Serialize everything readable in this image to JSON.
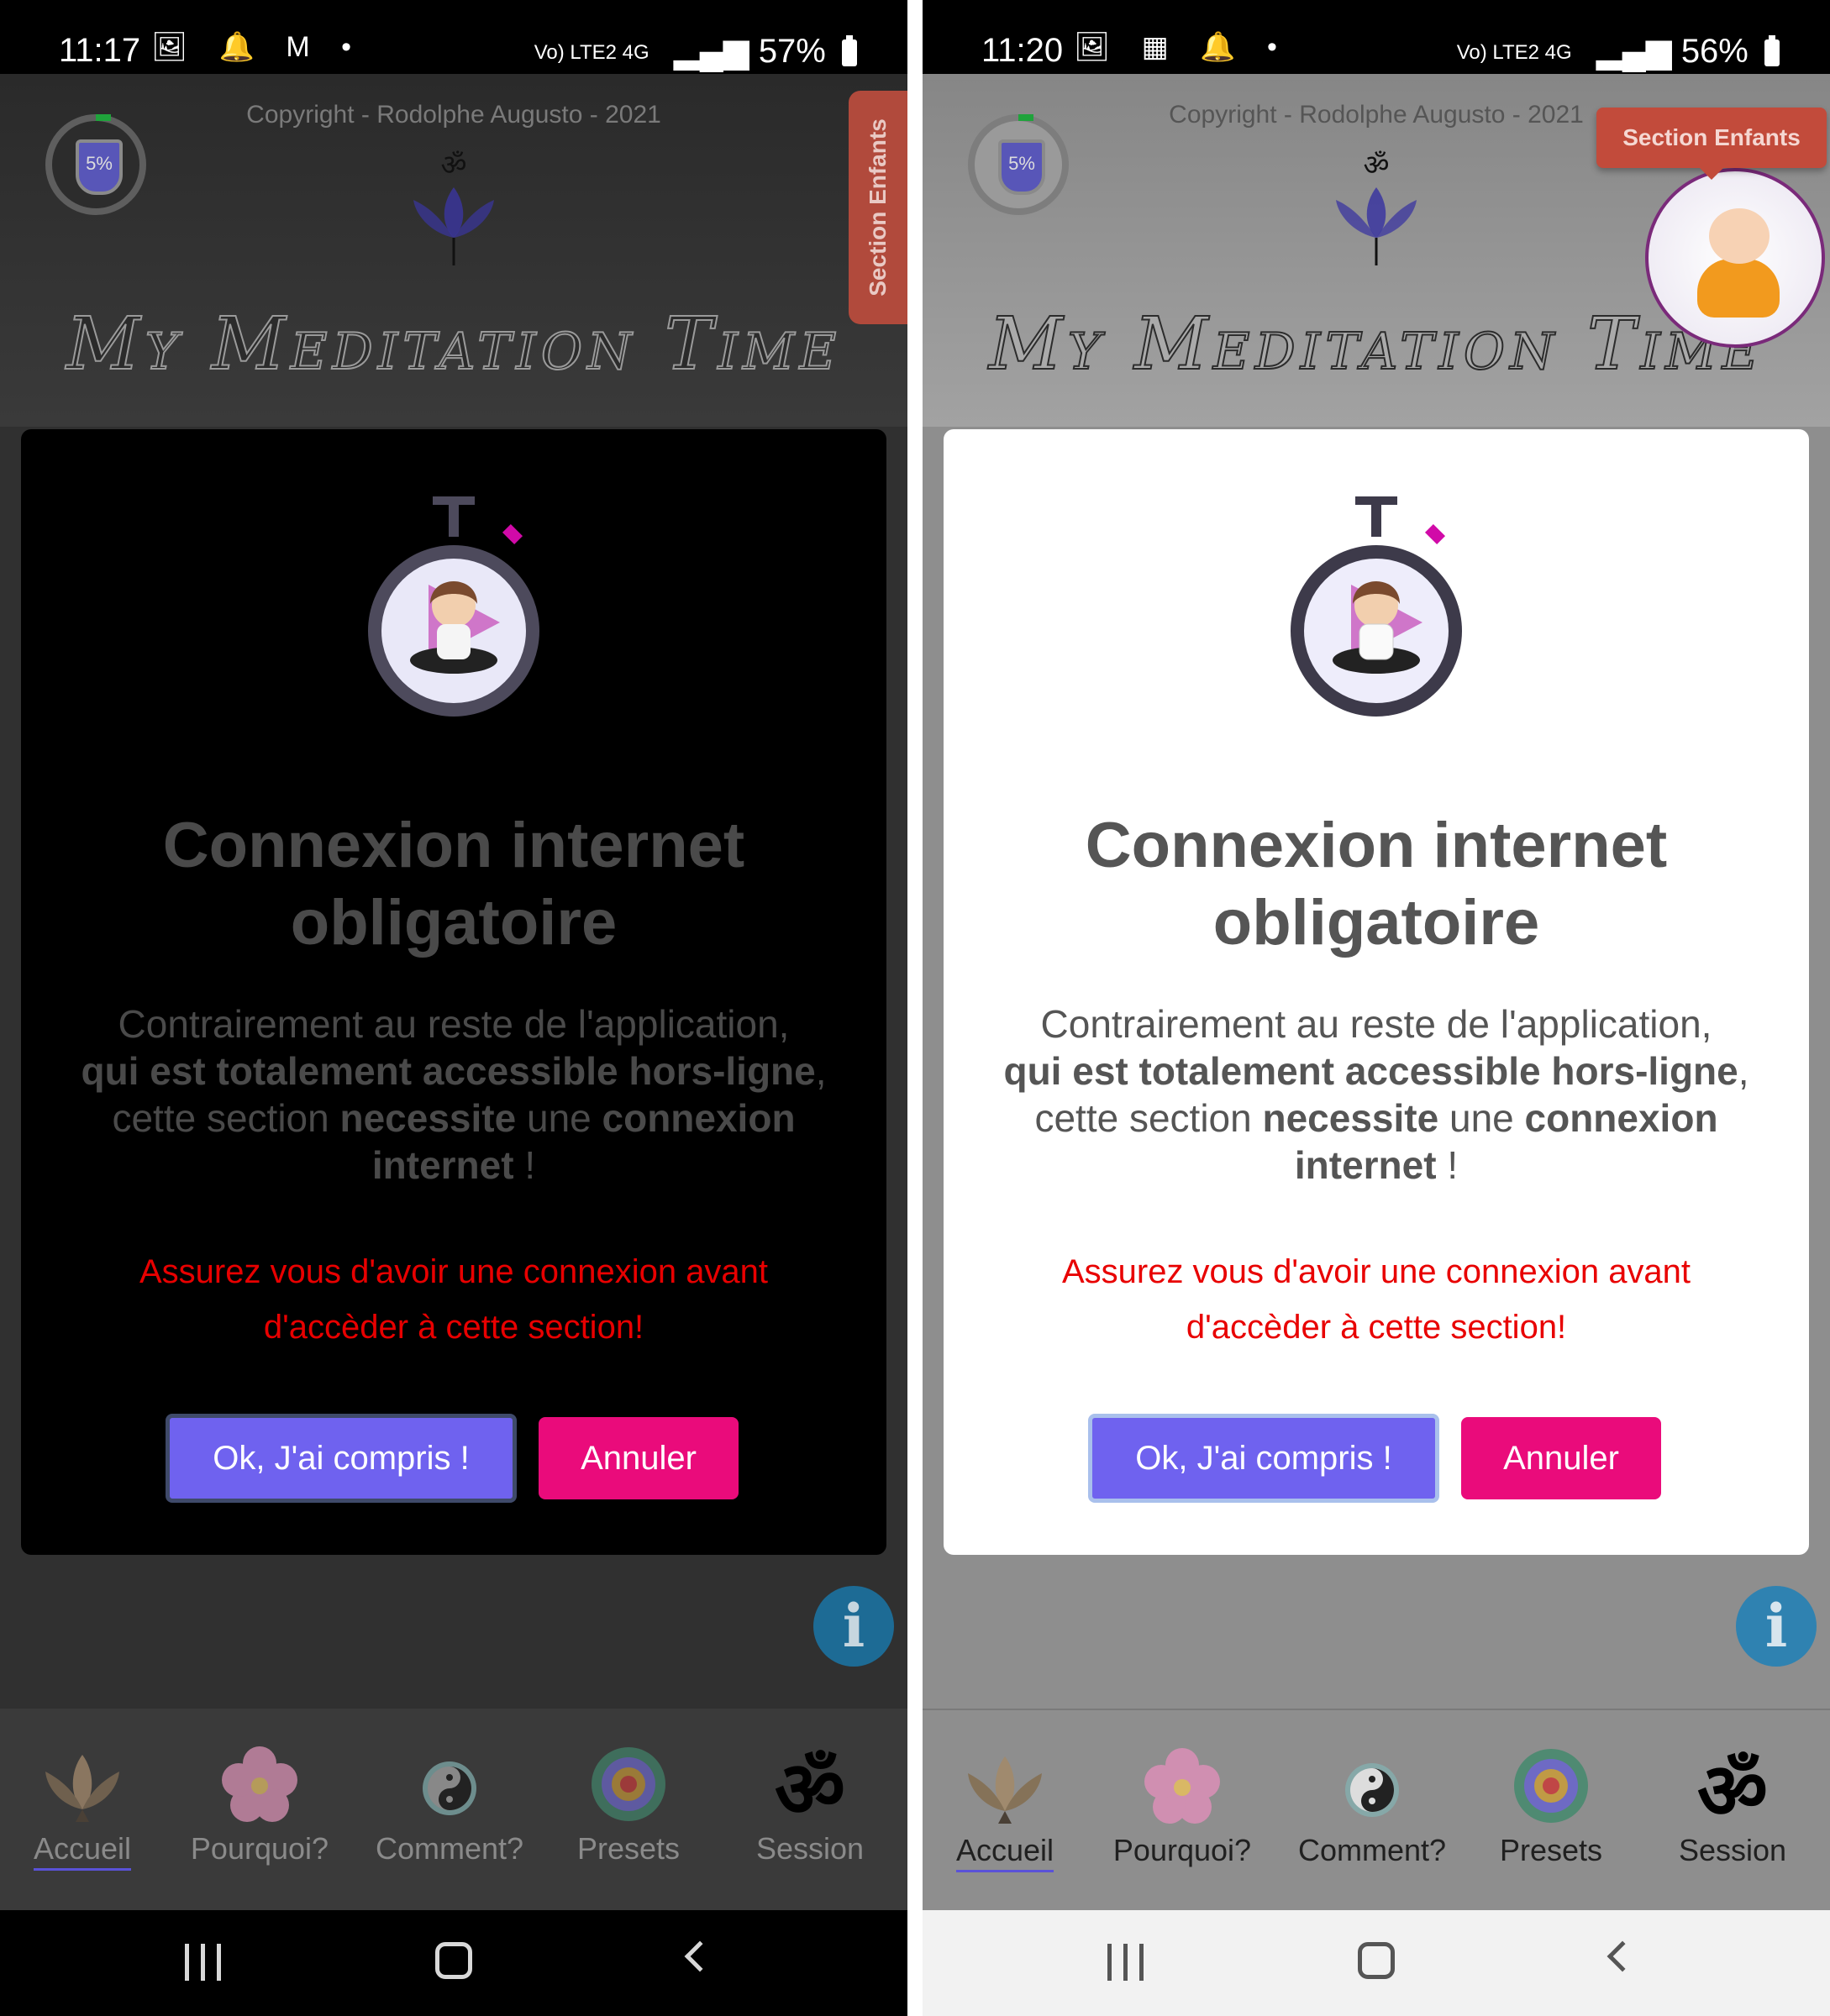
{
  "screens": [
    {
      "theme": "dark",
      "status": {
        "time": "11:17",
        "icons": "🖼 🔔 M •",
        "net": "Vo) LTE2 4G",
        "battery": "57%"
      },
      "copyright": "Copyright - Rodolphe Augusto - 2021",
      "progress_label": "5%",
      "progress_value_pct": 5,
      "app_title": "My Meditation Time",
      "kids_tab": "Section Enfants",
      "modal": {
        "title": "Connexion internet obligatoire",
        "body_1": "Contrairement au reste de l'application,",
        "body_bold_1": "qui est totalement accessible hors-ligne",
        "body_2": ",",
        "body_3": "cette section",
        "body_bold_2": "necessite",
        "body_4": "une",
        "body_bold_3": "connexion internet",
        "body_5": "!",
        "warning": "Assurez vous d'avoir une connexion avant d'accèder à cette section!",
        "ok_label": "Ok, J'ai compris !",
        "cancel_label": "Annuler"
      },
      "info_label": "i",
      "nav": [
        {
          "label": "Accueil",
          "icon": "lotus-icon",
          "active": true
        },
        {
          "label": "Pourquoi?",
          "icon": "flower-icon",
          "active": false
        },
        {
          "label": "Comment?",
          "icon": "yin-yang-icon",
          "active": false
        },
        {
          "label": "Presets",
          "icon": "mandala-icon",
          "active": false
        },
        {
          "label": "Session",
          "icon": "om-icon",
          "active": false
        }
      ]
    },
    {
      "theme": "light",
      "status": {
        "time": "11:20",
        "icons": "🖼 ▦ 🔔 •",
        "net": "Vo) LTE2 4G",
        "battery": "56%"
      },
      "copyright": "Copyright - Rodolphe Augusto - 2021",
      "progress_label": "5%",
      "progress_value_pct": 5,
      "app_title": "My Meditation Time",
      "kids_tab": "Section Enfants",
      "modal": {
        "title": "Connexion internet obligatoire",
        "body_1": "Contrairement au reste de l'application,",
        "body_bold_1": "qui est totalement accessible hors-ligne",
        "body_2": ",",
        "body_3": "cette section",
        "body_bold_2": "necessite",
        "body_4": "une",
        "body_bold_3": "connexion internet",
        "body_5": "!",
        "warning": "Assurez vous d'avoir une connexion avant d'accèder à cette section!",
        "ok_label": "Ok, J'ai compris !",
        "cancel_label": "Annuler"
      },
      "info_label": "i",
      "nav": [
        {
          "label": "Accueil",
          "icon": "lotus-icon",
          "active": true
        },
        {
          "label": "Pourquoi?",
          "icon": "flower-icon",
          "active": false
        },
        {
          "label": "Comment?",
          "icon": "yin-yang-icon",
          "active": false
        },
        {
          "label": "Presets",
          "icon": "mandala-icon",
          "active": false
        },
        {
          "label": "Session",
          "icon": "om-icon",
          "active": false
        }
      ]
    }
  ],
  "colors": {
    "primary_button": "#6f62ef",
    "cancel_button": "#ea0b7b",
    "warning_text": "#e80000",
    "kids_tab": "#c24b3b",
    "info_button": "#2f82b1"
  }
}
